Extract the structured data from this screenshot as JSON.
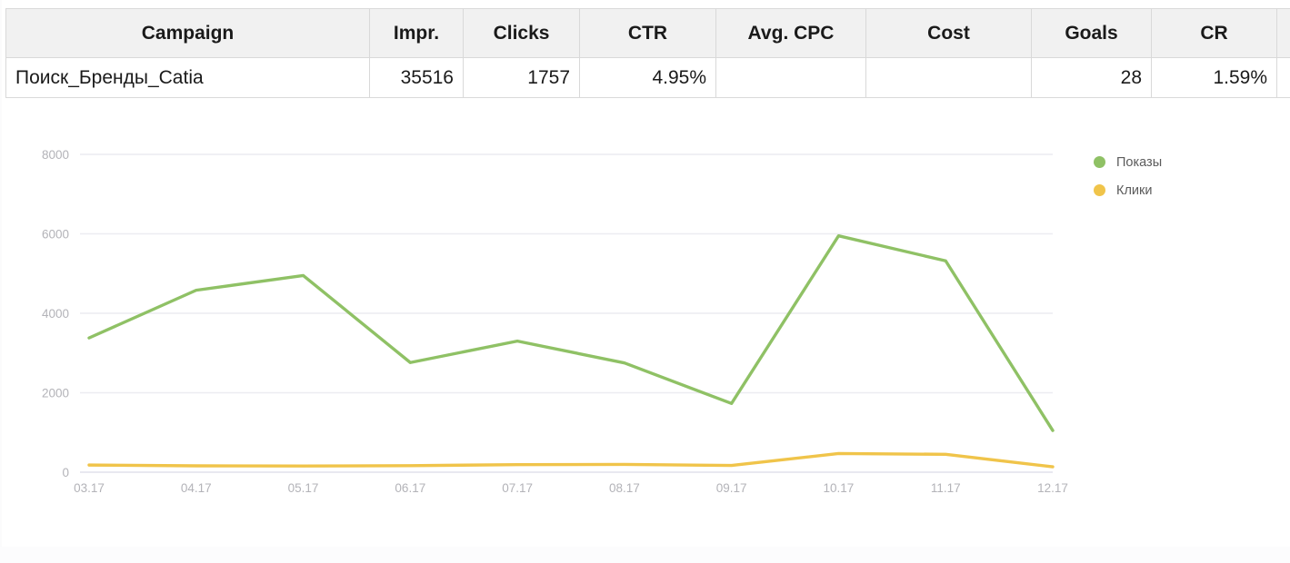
{
  "table": {
    "headers": [
      "Campaign",
      "Impr.",
      "Clicks",
      "CTR",
      "Avg. CPC",
      "Cost",
      "Goals",
      "CR"
    ],
    "rows": [
      {
        "campaign": "Поиск_Бренды_Catia",
        "impr": "35516",
        "clicks": "1757",
        "ctr": "4.95%",
        "avg_cpc": "",
        "cost": "",
        "goals": "28",
        "cr": "1.59%"
      }
    ]
  },
  "legend": {
    "items": [
      {
        "label": "Показы",
        "color": "#8FC165"
      },
      {
        "label": "Клики",
        "color": "#F0C44A"
      }
    ]
  },
  "chart_data": {
    "type": "line",
    "title": "",
    "xlabel": "",
    "ylabel": "",
    "x": [
      "03.17",
      "04.17",
      "05.17",
      "06.17",
      "07.17",
      "08.17",
      "09.17",
      "10.17",
      "11.17",
      "12.17"
    ],
    "categories": [
      "03.17",
      "04.17",
      "05.17",
      "06.17",
      "07.17",
      "08.17",
      "09.17",
      "10.17",
      "11.17",
      "12.17"
    ],
    "yticks": [
      0,
      2000,
      4000,
      6000,
      8000
    ],
    "ylim": [
      0,
      8000
    ],
    "grid": true,
    "legend_position": "right",
    "series": [
      {
        "name": "Показы",
        "color": "#8FC165",
        "values": [
          3380,
          4580,
          4950,
          2760,
          3300,
          2750,
          1730,
          5950,
          5320,
          1050
        ]
      },
      {
        "name": "Клики",
        "color": "#F0C44A",
        "values": [
          180,
          160,
          155,
          165,
          190,
          195,
          170,
          470,
          450,
          135
        ]
      }
    ]
  },
  "colors": {
    "series_green": "#8FC165",
    "series_yellow": "#F0C44A",
    "grid": "#ececf1",
    "axis_text": "#b3b3b8",
    "table_header_bg": "#f1f1f1",
    "table_border": "#d9d9d9"
  }
}
